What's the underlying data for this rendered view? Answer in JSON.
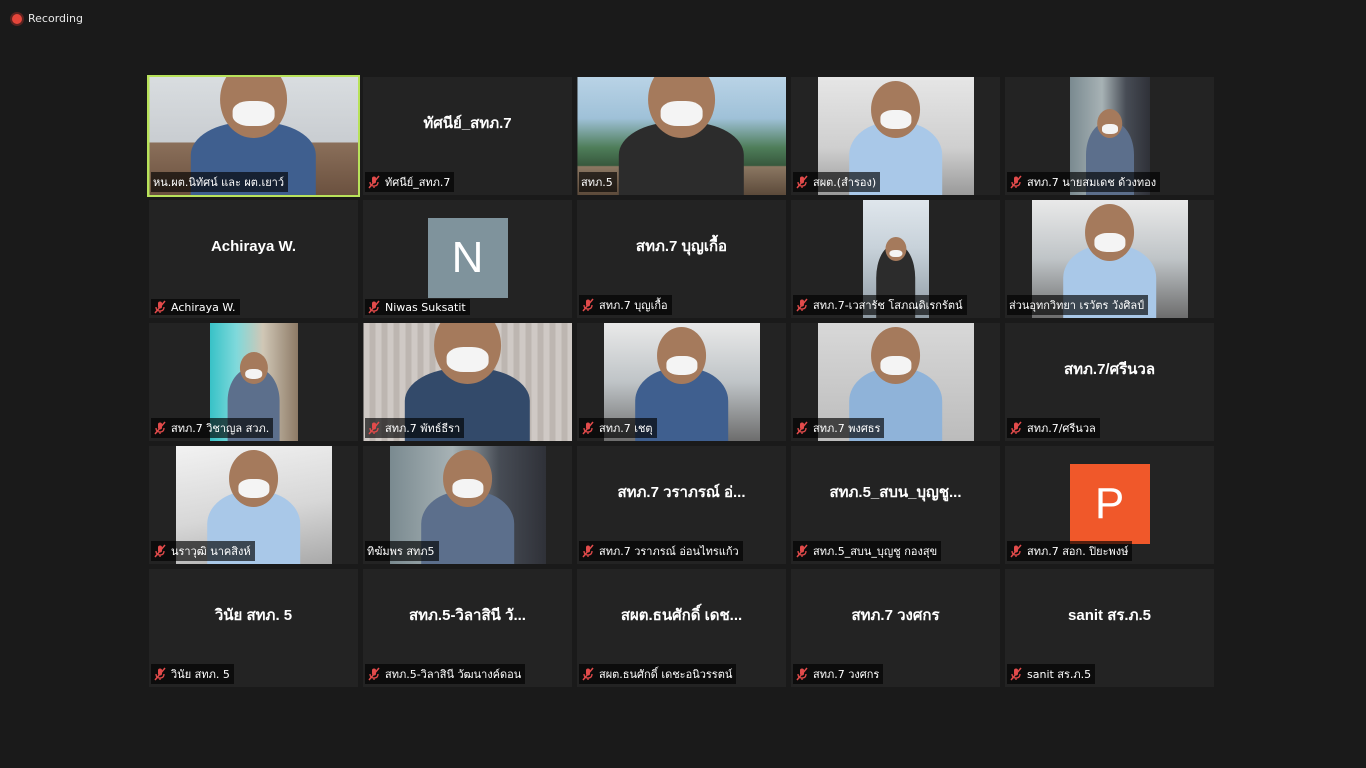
{
  "recording": {
    "label": "Recording"
  },
  "colors": {
    "active_speaker": "#b8e25a",
    "tile_bg": "#232323",
    "rec": "#e5453a",
    "mic_off": "#e24b4b"
  },
  "tiles": [
    {
      "id": "t1",
      "kind": "video",
      "scene": "office",
      "label": "หน.ผต.นิทัศน์ และ ผต.เยาว์",
      "muted": false,
      "active": true,
      "video_width": 209
    },
    {
      "id": "t2",
      "kind": "name",
      "display_name": "ทัศนีย์_สทภ.7",
      "label": "ทัศนีย์_สทภ.7",
      "muted": true
    },
    {
      "id": "t3",
      "kind": "video",
      "scene": "mountain",
      "label": "สทภ.5",
      "muted": false,
      "video_width": 209
    },
    {
      "id": "t4",
      "kind": "video",
      "scene": "room",
      "label": "สผต.(สำรอง)",
      "muted": true,
      "video_width": 156
    },
    {
      "id": "t5",
      "kind": "video",
      "scene": "shelf",
      "label": "สทภ.7 นายสมเดช ด้วงทอง",
      "muted": true,
      "video_width": 80
    },
    {
      "id": "t6",
      "kind": "name",
      "display_name": "Achiraya W.",
      "label": "Achiraya W.",
      "muted": true
    },
    {
      "id": "t7",
      "kind": "avatar",
      "letter": "N",
      "avatar_color": "#7f939c",
      "label": "Niwas Suksatit",
      "muted": true
    },
    {
      "id": "t8",
      "kind": "name",
      "display_name": "สทภ.7 บุญเกื้อ",
      "label": "สทภ.7 บุญเกื้อ",
      "muted": true
    },
    {
      "id": "t9",
      "kind": "video",
      "scene": "car",
      "label": "สทภ.7-เวสารัช โสภณดิเรกรัตน์",
      "muted": true,
      "video_width": 66
    },
    {
      "id": "t10",
      "kind": "video",
      "scene": "window",
      "label": "ส่วนอุทกวิทยา เรวัตร วังศิลป์",
      "muted": false,
      "video_width": 156
    },
    {
      "id": "t11",
      "kind": "video",
      "scene": "teal",
      "label": "สทภ.7 วิชาญล สวภ.",
      "muted": true,
      "video_width": 88
    },
    {
      "id": "t12",
      "kind": "video",
      "scene": "curtain",
      "label": "สทภ.7 พัทธ์ธีรา",
      "muted": true,
      "video_width": 209
    },
    {
      "id": "t13",
      "kind": "video",
      "scene": "office2",
      "label": "สทภ.7 เชตุ",
      "muted": true,
      "video_width": 156
    },
    {
      "id": "t14",
      "kind": "video",
      "scene": "plain",
      "label": "สทภ.7 พงศธร",
      "muted": true,
      "video_width": 156
    },
    {
      "id": "t15",
      "kind": "name",
      "display_name": "สทภ.7/ศรีนวล",
      "label": "สทภ.7/ศรีนวล",
      "muted": true
    },
    {
      "id": "t16",
      "kind": "video",
      "scene": "ceiling",
      "label": "นราวุฒิ นาคสิงห์",
      "muted": true,
      "video_width": 156
    },
    {
      "id": "t17",
      "kind": "video",
      "scene": "shelf2",
      "label": "ทิฆัมพร สทภ5",
      "muted": false,
      "video_width": 156
    },
    {
      "id": "t18",
      "kind": "name",
      "display_name": "สทภ.7 วราภรณ์ อ่...",
      "label": "สทภ.7 วราภรณ์ อ่อนไทรแก้ว",
      "muted": true
    },
    {
      "id": "t19",
      "kind": "name",
      "display_name": "สทภ.5_สบน_บุญชู...",
      "label": "สทภ.5_สบน_บุญชู กองสุข",
      "muted": true
    },
    {
      "id": "t20",
      "kind": "avatar",
      "letter": "P",
      "avatar_color": "#f0582a",
      "label": "สทภ.7 สอก. ปิยะพงษ์",
      "muted": true
    },
    {
      "id": "t21",
      "kind": "name",
      "display_name": "วินัย สทภ. 5",
      "label": "วินัย สทภ. 5",
      "muted": true
    },
    {
      "id": "t22",
      "kind": "name",
      "display_name": "สทภ.5-วิลาสินี วั...",
      "label": "สทภ.5-วิลาสินี วัฒนางค์ดอน",
      "muted": true
    },
    {
      "id": "t23",
      "kind": "name",
      "display_name": "สผต.ธนศักดิ์ เดช...",
      "label": "สผต.ธนศักดิ์ เดชะอนิวรรตน์",
      "muted": true
    },
    {
      "id": "t24",
      "kind": "name",
      "display_name": "สทภ.7 วงศกร",
      "label": "สทภ.7 วงศกร",
      "muted": true
    },
    {
      "id": "t25",
      "kind": "name",
      "display_name": "sanit สร.ภ.5",
      "label": "sanit สร.ภ.5",
      "muted": true
    }
  ]
}
